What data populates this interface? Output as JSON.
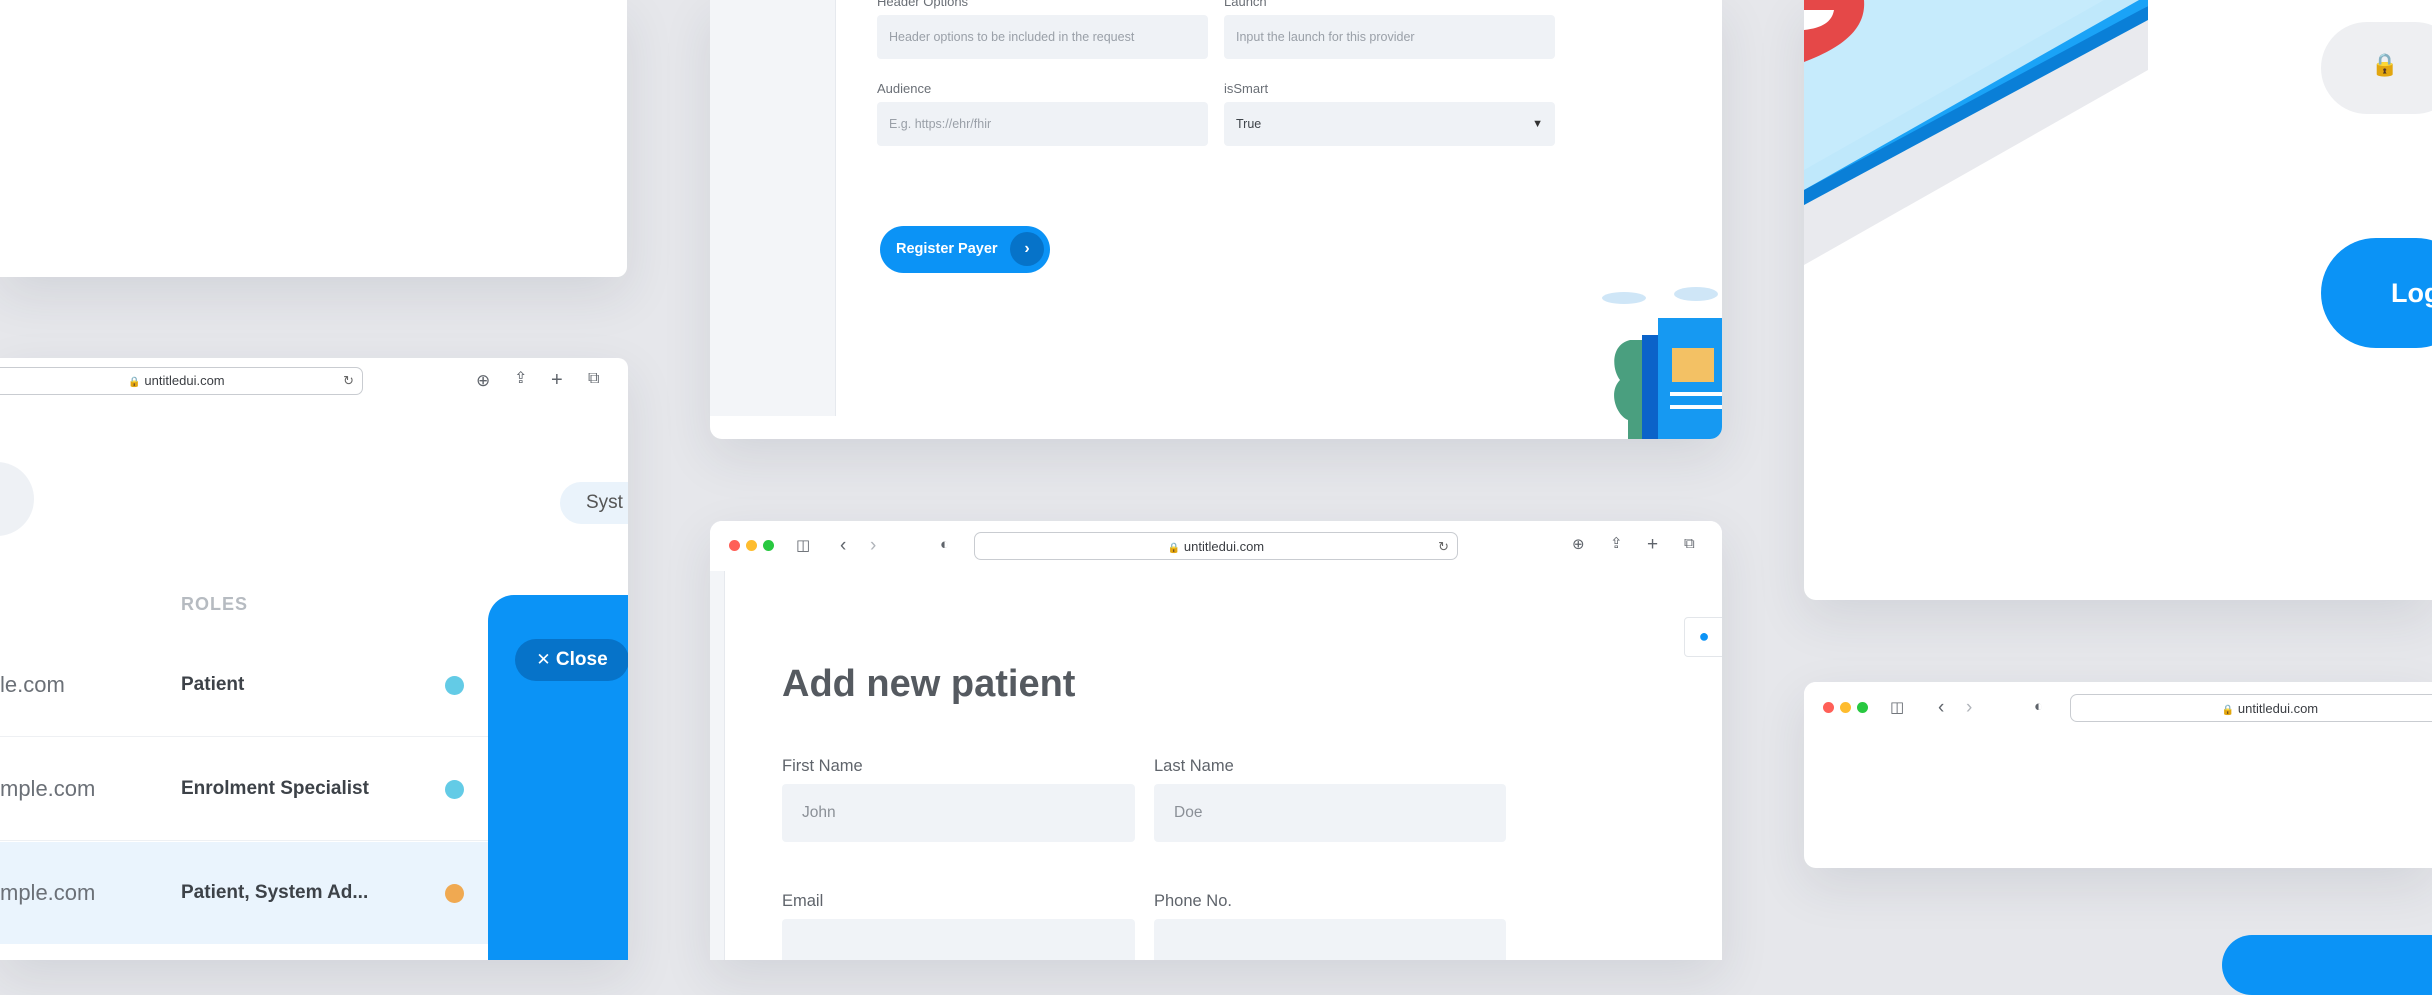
{
  "top_form": {
    "header_options_label": "Header Options",
    "header_options_placeholder": "Header options to be included in the request",
    "launch_label": "Launch",
    "launch_placeholder": "Input the launch for this provider",
    "audience_label": "Audience",
    "audience_placeholder": "E.g. https://ehr/fhir",
    "issmart_label": "isSmart",
    "issmart_value": "True",
    "register_button": "Register Payer"
  },
  "users_panel": {
    "url": "untitledui.com",
    "system_chip": "Syst",
    "roles_header": "ROLES",
    "rows": [
      {
        "email": "le.com",
        "role": "Patient",
        "status_color": "#63cbe6"
      },
      {
        "email": "mple.com",
        "role": "Enrolment Specialist",
        "status_color": "#63cbe6"
      },
      {
        "email": "mple.com",
        "role": "Patient, System Ad...",
        "status_color": "#f0a951"
      }
    ],
    "close_button": "Close"
  },
  "patient_form": {
    "url": "untitledui.com",
    "title": "Add new patient",
    "first_name_label": "First Name",
    "first_name_value": "John",
    "last_name_label": "Last Name",
    "last_name_value": "Doe",
    "email_label": "Email",
    "phone_label": "Phone No."
  },
  "login_panel": {
    "login_button": "Log"
  },
  "small_browser": {
    "url": "untitledui.com"
  },
  "colors": {
    "accent": "#0b93f6",
    "dot_red": "#ff5f57",
    "dot_yellow": "#febc2e",
    "dot_green": "#28c840"
  }
}
